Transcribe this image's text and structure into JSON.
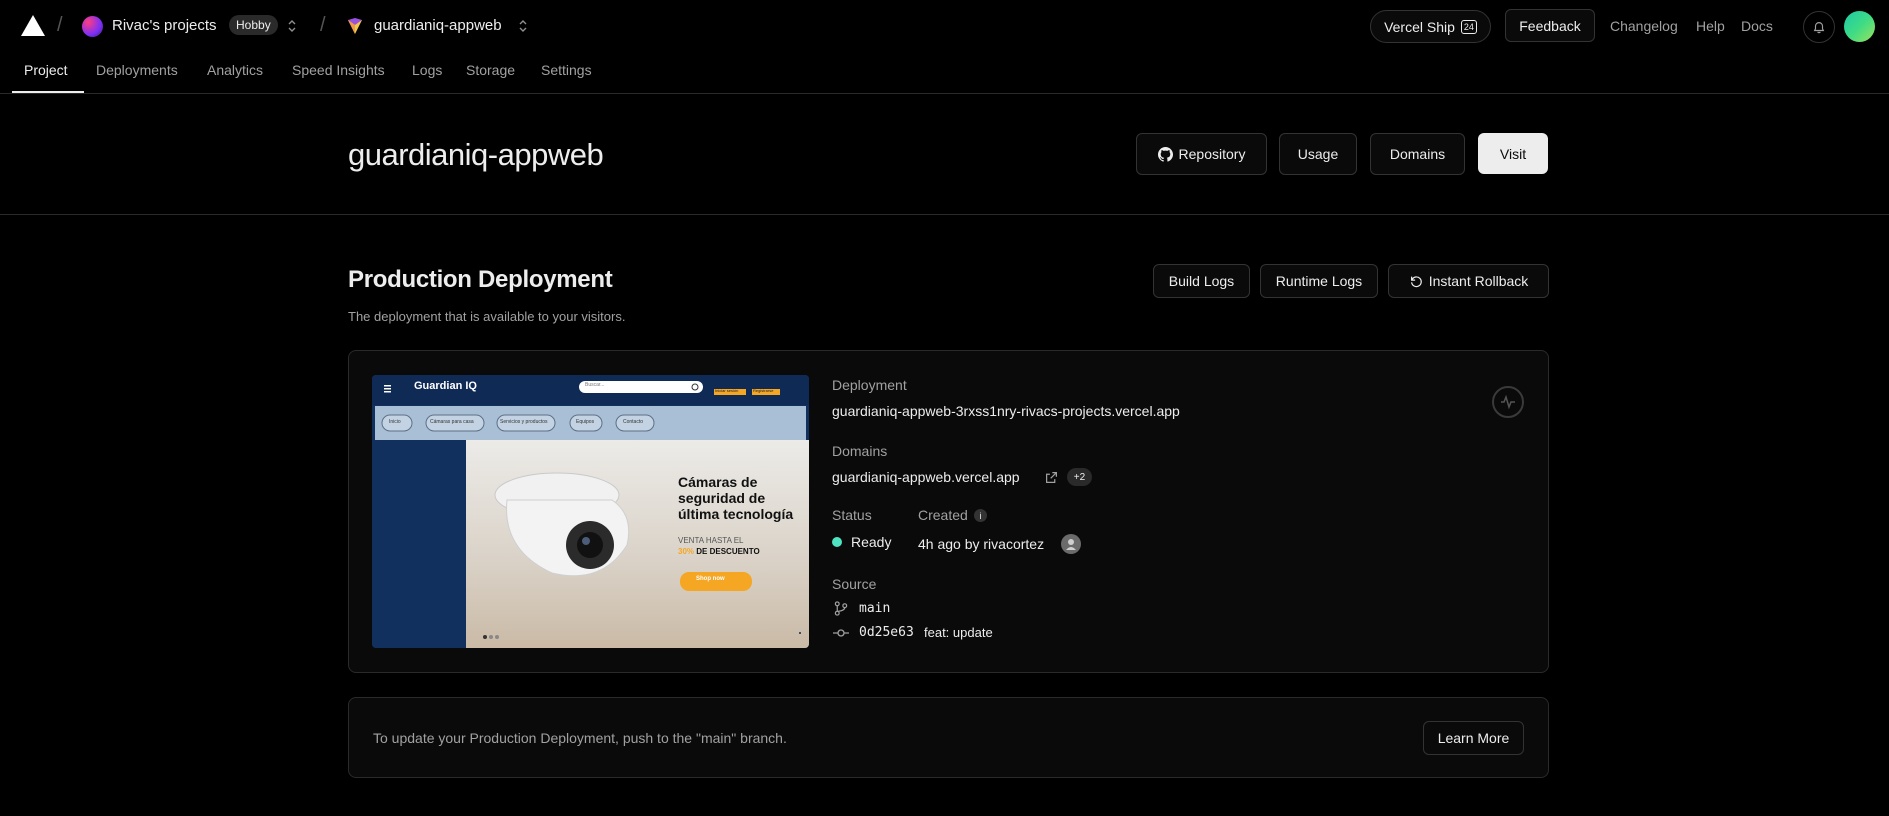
{
  "topbar": {
    "team_name": "Rivac's projects",
    "team_plan": "Hobby",
    "project_name": "guardianiq-appweb",
    "vercel_ship_label": "Vercel Ship",
    "vercel_ship_badge": "24",
    "feedback_label": "Feedback",
    "links": [
      "Changelog",
      "Help",
      "Docs"
    ]
  },
  "tabs": [
    {
      "label": "Project",
      "active": true
    },
    {
      "label": "Deployments"
    },
    {
      "label": "Analytics"
    },
    {
      "label": "Speed Insights"
    },
    {
      "label": "Logs"
    },
    {
      "label": "Storage"
    },
    {
      "label": "Settings"
    }
  ],
  "header": {
    "title": "guardianiq-appweb",
    "buttons": {
      "repository": "Repository",
      "usage": "Usage",
      "domains": "Domains",
      "visit": "Visit"
    }
  },
  "production": {
    "title": "Production Deployment",
    "subtitle": "The deployment that is available to your visitors.",
    "buttons": {
      "build_logs": "Build Logs",
      "runtime_logs": "Runtime Logs",
      "instant_rollback": "Instant Rollback"
    },
    "deployment_label": "Deployment",
    "deployment_url": "guardianiq-appweb-3rxss1nry-rivacs-projects.vercel.app",
    "domains_label": "Domains",
    "domain": "guardianiq-appweb.vercel.app",
    "domains_more": "+2",
    "status_label": "Status",
    "status_value": "Ready",
    "created_label": "Created",
    "created_value": "4h ago by rivacortez",
    "info_glyph": "i",
    "source_label": "Source",
    "branch": "main",
    "commit_hash": "0d25e63",
    "commit_message": "feat: update"
  },
  "preview": {
    "brand": "Guardian IQ",
    "search_placeholder": "Buscar...",
    "top_buttons": [
      "Iniciar sesión",
      "Registrarse"
    ],
    "nav_pills": [
      "Inicio",
      "Cámaras para casa",
      "Servicios y productos",
      "Equipos",
      "Contacto"
    ],
    "headline_lines": [
      "Cámaras de",
      "seguridad de",
      "última tecnología"
    ],
    "sale_line1": "VENTA HASTA EL",
    "sale_pct": "30%",
    "sale_line2": "DE DESCUENTO",
    "shop_now": "Shop now"
  },
  "notice": {
    "text": "To update your Production Deployment, push to the \"main\" branch.",
    "learn_more": "Learn More"
  },
  "colors": {
    "background": "#000000",
    "status_ready": "#50e3c2",
    "accent_orange": "#f5a623"
  },
  "icons": [
    "vercel-logo-icon",
    "chevron-updown-icon",
    "github-icon",
    "bell-icon",
    "rollback-icon",
    "external-link-icon",
    "git-branch-icon",
    "git-commit-icon",
    "activity-icon"
  ]
}
